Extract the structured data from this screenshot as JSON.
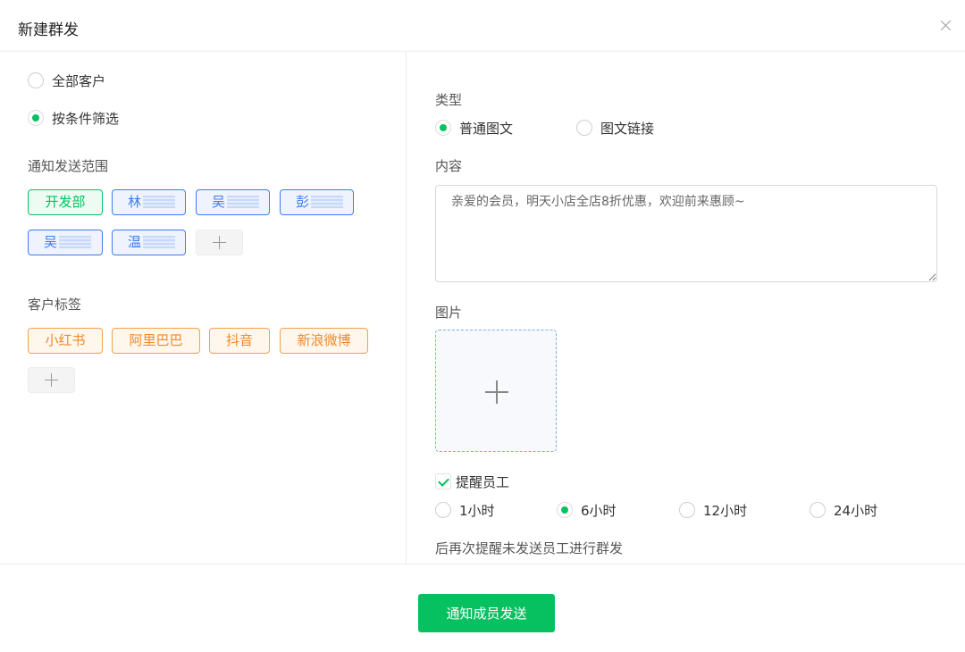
{
  "dialog": {
    "title": "新建群发",
    "close_icon": "close-icon"
  },
  "audience": {
    "options": [
      {
        "label": "全部客户",
        "checked": false
      },
      {
        "label": "按条件筛选",
        "checked": true
      }
    ]
  },
  "scope": {
    "label": "通知发送范围",
    "tags": [
      {
        "label": "开发部",
        "style": "green"
      },
      {
        "label": "林",
        "style": "blue"
      },
      {
        "label": "吴",
        "style": "blue"
      },
      {
        "label": "彭",
        "style": "blue"
      },
      {
        "label": "吴",
        "style": "blue"
      },
      {
        "label": "温",
        "style": "blue"
      }
    ],
    "add_icon": "plus-icon"
  },
  "customer_tags": {
    "label": "客户标签",
    "tags": [
      "小红书",
      "阿里巴巴",
      "抖音",
      "新浪微博"
    ],
    "add_icon": "plus-icon"
  },
  "type": {
    "label": "类型",
    "options": [
      {
        "label": "普通图文",
        "checked": true
      },
      {
        "label": "图文链接",
        "checked": false
      }
    ]
  },
  "content": {
    "label": "内容",
    "value": "亲爱的会员，明天小店全店8折优惠，欢迎前来惠顾~"
  },
  "image": {
    "label": "图片",
    "upload_icon": "plus-icon"
  },
  "remind": {
    "checkbox_label": "提醒员工",
    "checked": true,
    "options": [
      {
        "label": "1小时",
        "checked": false
      },
      {
        "label": "6小时",
        "checked": true
      },
      {
        "label": "12小时",
        "checked": false
      },
      {
        "label": "24小时",
        "checked": false
      }
    ],
    "hint": "后再次提醒未发送员工进行群发"
  },
  "footer": {
    "submit_label": "通知成员发送"
  },
  "colors": {
    "primary": "#07c160",
    "tag_blue": "#3c7cf0",
    "tag_orange": "#ef8a2a"
  }
}
